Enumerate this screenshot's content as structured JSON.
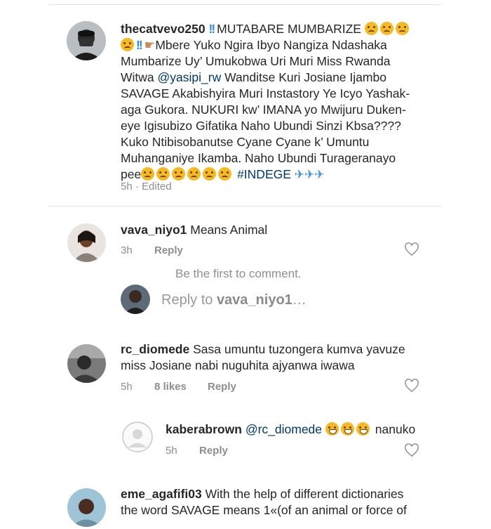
{
  "comments": [
    {
      "username": "thecatvevo250",
      "text_lines": {
        "l1": "MUTABARE MUMBARIZE",
        "l2": "Mbere Yuko Ngira Ibyo Nangiza Ndashaka",
        "l3": "Mumbarize Uy’ Umukobwa Uri Muri Miss Rwanda",
        "l4_pre": "Witwa ",
        "l4_mention": "@yasipi_rw",
        "l4_post": " Wanditse Kuri Josiane Ijambo",
        "l5": "SAVAGE Akabishyira Muri Instastory Ye Icyo Yashak-",
        "l6": "aga Gukora. NUKURI kw’ IMANA yo Mwijuru Duken-",
        "l7": "eye Igisubizo Gifatika Naho Ubundi Sinzi Kbsa????",
        "l8": "Kuko  Ntibisobanutse Cyane Cyane k’ Umuntu",
        "l9": "Muhanganiye Ikamba. Naho Ubundi Turageranayo",
        "l10_pre": "pee",
        "l10_tag": "#INDEGE"
      },
      "time": "5h",
      "edited": "· Edited"
    },
    {
      "username": "vava_niyo1",
      "text": "Means  Animal",
      "time": "3h",
      "reply_label": "Reply"
    },
    {
      "username": "rc_diomede",
      "line1": "Sasa umuntu tuzongera kumva yavuze",
      "line2": "miss Josiane nabi nuguhita ajyanwa iwawa",
      "time": "5h",
      "likes": "8 likes",
      "reply_label": "Reply"
    },
    {
      "username": "kaberabrown",
      "mention": "@rc_diomede",
      "text": "nanuko",
      "time": "5h",
      "reply_label": "Reply"
    },
    {
      "username": "eme_agafifi03",
      "line1": "With the help of different dictionaries",
      "line2": "the word SAVAGE means  1«(of an animal or force of"
    }
  ],
  "no_replies_text": "Be the first to comment.",
  "reply_input": {
    "prefix": "Reply to ",
    "target": "vava_niyo1",
    "suffix": "…"
  },
  "colors": {
    "text": "#262626",
    "secondary": "#8e8e8e",
    "mention": "#00376b",
    "hashtag": "#00376b"
  },
  "icons": [
    "heart-icon",
    "avatar"
  ]
}
